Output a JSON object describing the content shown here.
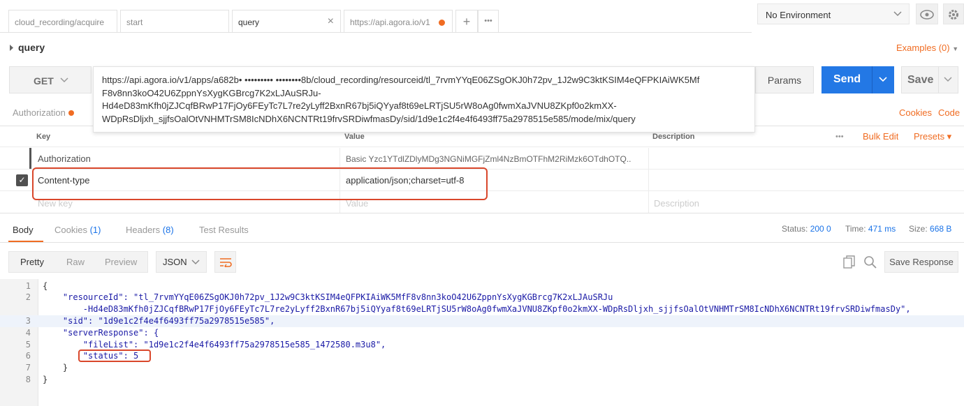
{
  "tabs": [
    {
      "label": "cloud_recording/acquire"
    },
    {
      "label": "start"
    },
    {
      "label": "query",
      "close": "×"
    },
    {
      "label": "https://api.agora.io/v1"
    }
  ],
  "tab_actions": {
    "add": "+",
    "more": "•••"
  },
  "environment": {
    "selected": "No Environment"
  },
  "request": {
    "name": "query",
    "examples": "Examples (0)",
    "method": "GET",
    "url_lines": [
      "https://api.agora.io/v1/apps/a682b• •••••••••  ••••••••8b/cloud_recording/resourceid/tl_7rvmYYqE06ZSgOKJ0h72pv_1J2w9C3ktKSIM4eQFPKIAiWK5Mf",
      "F8v8nn3koO42U6ZppnYsXygKGBrcg7K2xLJAuSRJu-",
      "Hd4eD83mKfh0jZJCqfBRwP17FjOy6FEyTc7L7re2yLyff2BxnR67bj5iQYyaf8t69eLRTjSU5rW8oAg0fwmXaJVNU8ZKpf0o2kmXX-",
      "WDpRsDljxh_sjjfsOalOtVNHMTrSM8IcNDhX6NCNTRt19frvSRDiwfmasDy/sid/1d9e1c2f4e4f6493ff75a2978515e585/mode/mix/query"
    ],
    "params_label": "Params",
    "send_label": "Send",
    "save_label": "Save"
  },
  "subtabs": {
    "authorization": "Authorization",
    "cookies": "Cookies",
    "code": "Code"
  },
  "headers_table": {
    "col_key": "Key",
    "col_value": "Value",
    "col_description": "Description",
    "more": "•••",
    "bulk_edit": "Bulk Edit",
    "presets": "Presets ▾",
    "rows": [
      {
        "key": "Authorization",
        "value": "Basic Yzc1YTdlZDlyMDg3NGNiMGFjZml4NzBmOTFhM2RiMzk6OTdhOTQ..",
        "description": ""
      },
      {
        "key": "Content-type",
        "value": "application/json;charset=utf-8",
        "description": ""
      }
    ],
    "new_row": {
      "key": "New key",
      "value": "Value",
      "description": "Description"
    }
  },
  "response": {
    "tabs": {
      "body": "Body",
      "cookies": "Cookies",
      "cookies_count": "(1)",
      "headers": "Headers",
      "headers_count": "(8)",
      "test_results": "Test Results"
    },
    "status_label": "Status:",
    "status_value": "200 0",
    "time_label": "Time:",
    "time_value": "471 ms",
    "size_label": "Size:",
    "size_value": "668 B",
    "view_modes": [
      "Pretty",
      "Raw",
      "Preview"
    ],
    "format": "JSON",
    "save_response": "Save Response",
    "code_lines": [
      {
        "n": "1",
        "text": "{"
      },
      {
        "n": "2",
        "text": "    \"resourceId\": \"tl_7rvmYYqE06ZSgOKJ0h72pv_1J2w9C3ktKSIM4eQFPKIAiWK5MfF8v8nn3koO42U6ZppnYsXygKGBrcg7K2xLJAuSRJu"
      },
      {
        "n": "",
        "text": "        -Hd4eD83mKfh0jZJCqfBRwP17FjOy6FEyTc7L7re2yLyff2BxnR67bj5iQYyaf8t69eLRTjSU5rW8oAg0fwmXaJVNU8ZKpf0o2kmXX-WDpRsDljxh_sjjfsOalOtVNHMTrSM8IcNDhX6NCNTRt19frvSRDiwfmasDy\","
      },
      {
        "n": "3",
        "text": "    \"sid\": \"1d9e1c2f4e4f6493ff75a2978515e585\","
      },
      {
        "n": "4",
        "text": "    \"serverResponse\": {"
      },
      {
        "n": "5",
        "text": "        \"fileList\": \"1d9e1c2f4e4f6493ff75a2978515e585_1472580.m3u8\","
      },
      {
        "n": "6",
        "text": "        \"status\": 5"
      },
      {
        "n": "7",
        "text": "    }"
      },
      {
        "n": "8",
        "text": "}"
      }
    ]
  }
}
